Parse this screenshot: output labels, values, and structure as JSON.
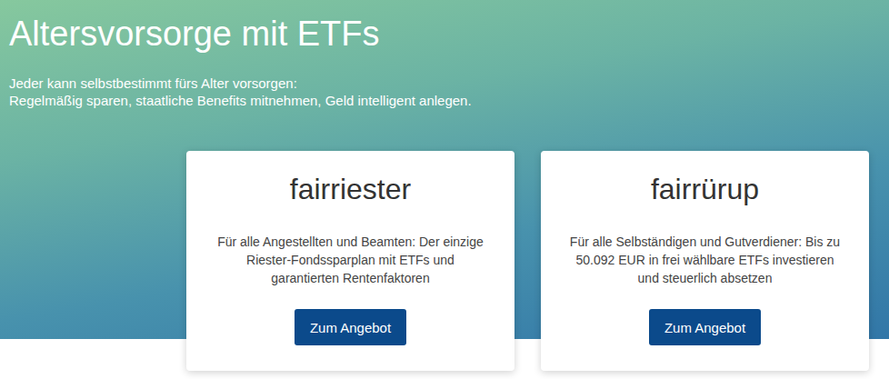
{
  "header": {
    "title": "Altersvorsorge mit ETFs",
    "subtitle": [
      "Jeder kann selbstbestimmt fürs Alter vorsorgen:",
      "Regelmäßig sparen, staatliche Benefits mitnehmen, Geld intelligent anlegen."
    ]
  },
  "cards": [
    {
      "title": "fairriester",
      "description": "Für alle Angestellten und Beamten: Der einzige Riester-Fondssparplan mit ETFs und garantierten Rentenfaktoren",
      "button": "Zum Angebot"
    },
    {
      "title": "fairrürup",
      "description": "Für alle Selbständigen und Gutverdiener: Bis zu 50.092 EUR in frei wählbare ETFs investieren und steuerlich absetzen",
      "button": "Zum Angebot"
    }
  ]
}
